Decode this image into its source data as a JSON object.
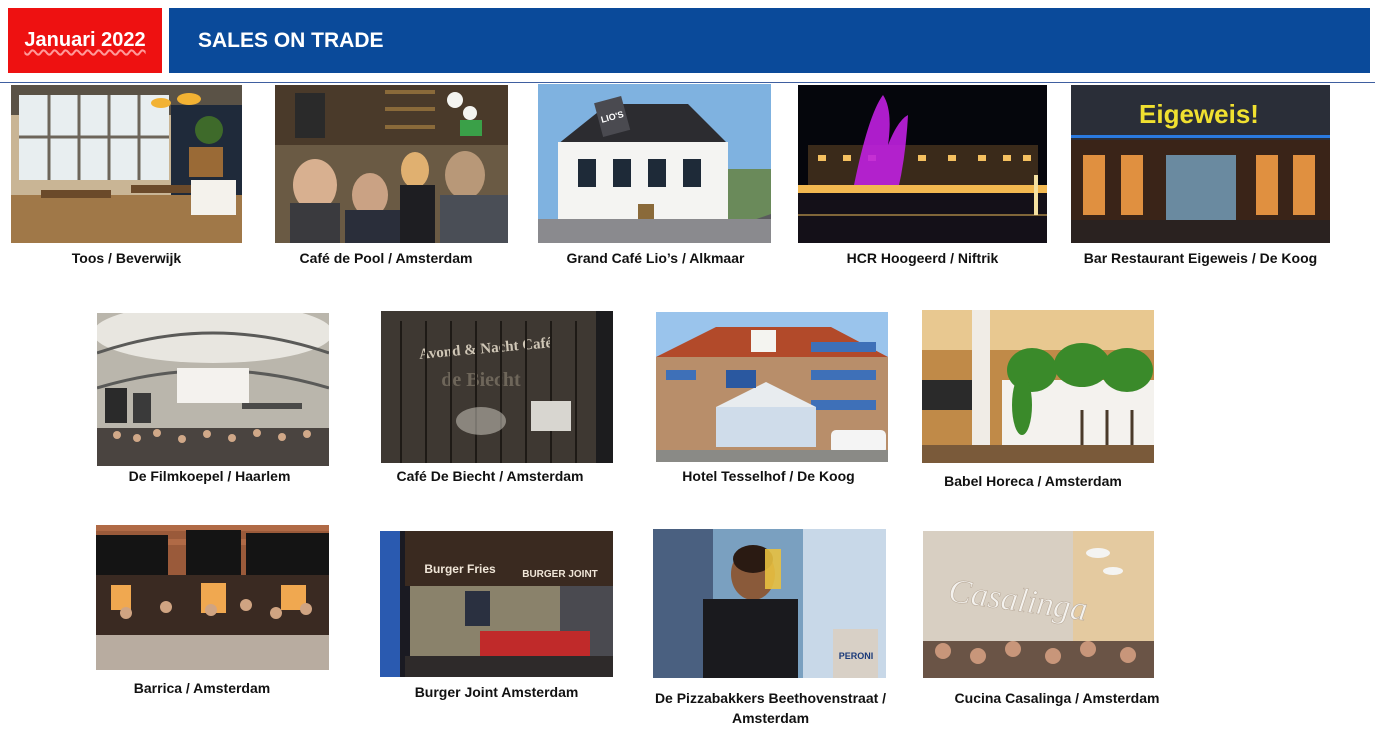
{
  "header": {
    "date_label": "Januari 2022",
    "title": "SALES ON TRADE"
  },
  "colors": {
    "date_bg": "#ee1111",
    "title_bg": "#0a4a9a",
    "rule": "#3f5fa0"
  },
  "venues": [
    {
      "caption": "Toos / Beverwijk"
    },
    {
      "caption": "Café de Pool / Amsterdam"
    },
    {
      "caption": "Grand Café Lio’s / Alkmaar",
      "sign": "LIO'S"
    },
    {
      "caption": "HCR Hoogeerd / Niftrik"
    },
    {
      "caption": "Bar Restaurant Eigeweis / De Koog",
      "sign": "Eigeweis!"
    },
    {
      "caption": "De Filmkoepel / Haarlem"
    },
    {
      "caption": "Café De Biecht / Amsterdam",
      "sign": "Avond & Nacht Café"
    },
    {
      "caption": "Hotel Tesselhof / De Koog"
    },
    {
      "caption": "Babel Horeca / Amsterdam"
    },
    {
      "caption": "Barrica / Amsterdam"
    },
    {
      "caption": "Burger Joint Amsterdam",
      "sign": "Burger Fries",
      "sign2": "BURGER JOINT"
    },
    {
      "caption": "De Pizzabakkers Beethovenstraat / Amsterdam"
    },
    {
      "caption": "Cucina Casalinga / Amsterdam",
      "sign": "Casalinga"
    }
  ]
}
